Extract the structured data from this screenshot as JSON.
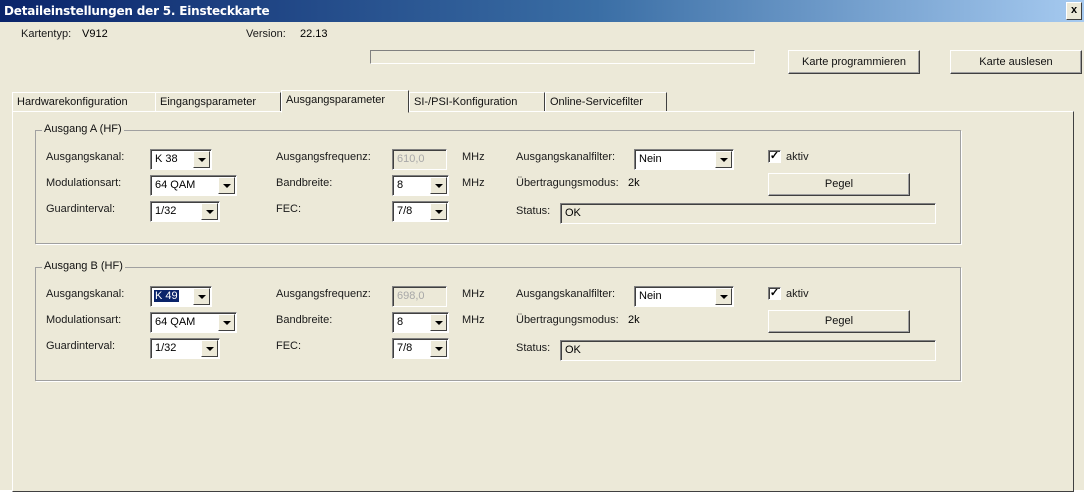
{
  "window": {
    "title": "Detaileinstellungen der 5. Einsteckkarte",
    "close": "x"
  },
  "header": {
    "kartentyp_label": "Kartentyp:",
    "kartentyp_value": "V912",
    "version_label": "Version:",
    "version_value": "22.13",
    "progress": 0,
    "btn_program": "Karte programmieren",
    "btn_read": "Karte auslesen"
  },
  "tabs": [
    {
      "label": "Hardwarekonfiguration"
    },
    {
      "label": "Eingangsparameter"
    },
    {
      "label": "Ausgangsparameter",
      "active": true
    },
    {
      "label": "SI-/PSI-Konfiguration"
    },
    {
      "label": "Online-Servicefilter"
    }
  ],
  "labels": {
    "ausgangskanal": "Ausgangskanal:",
    "modulationsart": "Modulationsart:",
    "guardinterval": "Guardinterval:",
    "ausgangsfrequenz": "Ausgangsfrequenz:",
    "bandbreite": "Bandbreite:",
    "fec": "FEC:",
    "mhz": "MHz",
    "kanalfilter": "Ausgangskanalfilter:",
    "uebertragungsmodus": "Übertragungsmodus:",
    "status": "Status:",
    "aktiv": "aktiv",
    "pegel": "Pegel"
  },
  "groups": [
    {
      "title": "Ausgang A (HF)",
      "ausgangskanal": "K 38",
      "modulationsart": "64 QAM",
      "guardinterval": "1/32",
      "ausgangsfrequenz": "610,0",
      "bandbreite": "8",
      "fec": "7/8",
      "kanalfilter": "Nein",
      "uebertragungsmodus": "2k",
      "status": "OK",
      "aktiv": true
    },
    {
      "title": "Ausgang B (HF)",
      "ausgangskanal": "K 49",
      "modulationsart": "64 QAM",
      "guardinterval": "1/32",
      "ausgangsfrequenz": "698,0",
      "bandbreite": "8",
      "fec": "7/8",
      "kanalfilter": "Nein",
      "uebertragungsmodus": "2k",
      "status": "OK",
      "aktiv": true
    }
  ],
  "colors": {
    "titlebar_start": "#0a246a",
    "dialog_bg": "#ece9d8"
  }
}
